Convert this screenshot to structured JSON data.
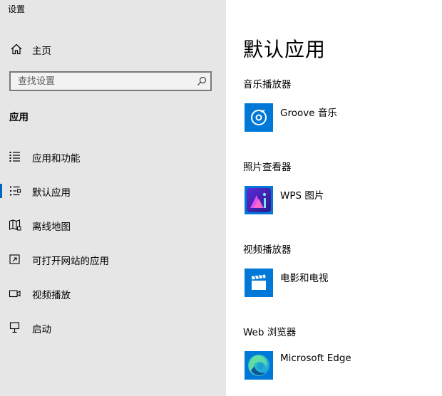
{
  "window": {
    "title": "设置"
  },
  "sidebar": {
    "home_label": "主页",
    "search": {
      "placeholder": "查找设置"
    },
    "section_header": "应用",
    "items": [
      {
        "label": "应用和功能",
        "icon": "apps-list-icon",
        "selected": false
      },
      {
        "label": "默认应用",
        "icon": "default-apps-icon",
        "selected": true
      },
      {
        "label": "离线地图",
        "icon": "offline-map-icon",
        "selected": false
      },
      {
        "label": "可打开网站的应用",
        "icon": "open-website-icon",
        "selected": false
      },
      {
        "label": "视频播放",
        "icon": "video-playback-icon",
        "selected": false
      },
      {
        "label": "启动",
        "icon": "startup-icon",
        "selected": false
      }
    ]
  },
  "main": {
    "title": "默认应用",
    "categories": [
      {
        "label": "音乐播放器",
        "app_name": "Groove 音乐",
        "app_icon": "groove-music-icon"
      },
      {
        "label": "照片查看器",
        "app_name": "WPS 图片",
        "app_icon": "wps-pictures-icon"
      },
      {
        "label": "视频播放器",
        "app_name": "电影和电视",
        "app_icon": "movies-tv-icon"
      },
      {
        "label": "Web 浏览器",
        "app_name": "Microsoft Edge",
        "app_icon": "edge-browser-icon"
      }
    ]
  },
  "colors": {
    "sidebar_bg": "#e6e6e6",
    "accent": "#0067c0",
    "app_tile_blue": "#0078d7"
  }
}
